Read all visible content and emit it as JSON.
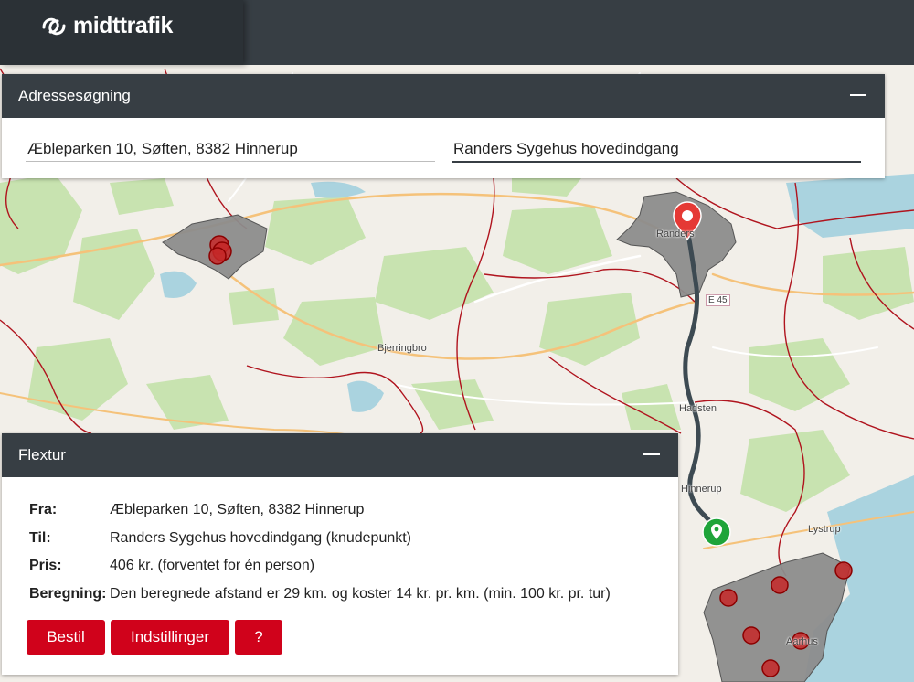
{
  "header": {
    "logo_text": "midttrafik",
    "logo_icon": "midttrafik-logo-icon"
  },
  "address_panel": {
    "title": "Adressesøgning",
    "from_value": "Æbleparken 10, Søften, 8382 Hinnerup",
    "to_value": "Randers Sygehus hovedindgang"
  },
  "flextur_panel": {
    "title": "Flextur",
    "rows": [
      {
        "label": "Fra:",
        "value": "Æbleparken 10, Søften, 8382 Hinnerup"
      },
      {
        "label": "Til:",
        "value": "Randers Sygehus hovedindgang (knudepunkt)"
      },
      {
        "label": "Pris:",
        "value": "406 kr. (forventet for én person)"
      },
      {
        "label": "Beregning:",
        "value": "Den beregnede afstand er 29 km. og koster 14 kr. pr. km. (min. 100 kr. pr. tur)"
      }
    ],
    "buttons": {
      "order": "Bestil",
      "settings": "Indstillinger",
      "help": "?"
    }
  },
  "map": {
    "labels": {
      "randers": "Randers",
      "bjerringbro": "Bjerringbro",
      "e45": "E 45",
      "hadsten": "Hadsten",
      "hinnerup": "Hinnerup",
      "lystrup": "Lystrup",
      "aarhus": "Aarhus"
    },
    "colors": {
      "land": "#f2efe9",
      "forest": "#c8e3b0",
      "water": "#aad3df",
      "urban": "#8c8c8c",
      "border": "#b0141e",
      "route": "#3d4a52",
      "destination_pin": "#e53935",
      "origin_pin": "#1fa43a",
      "stop_marker": "#c62828"
    }
  }
}
